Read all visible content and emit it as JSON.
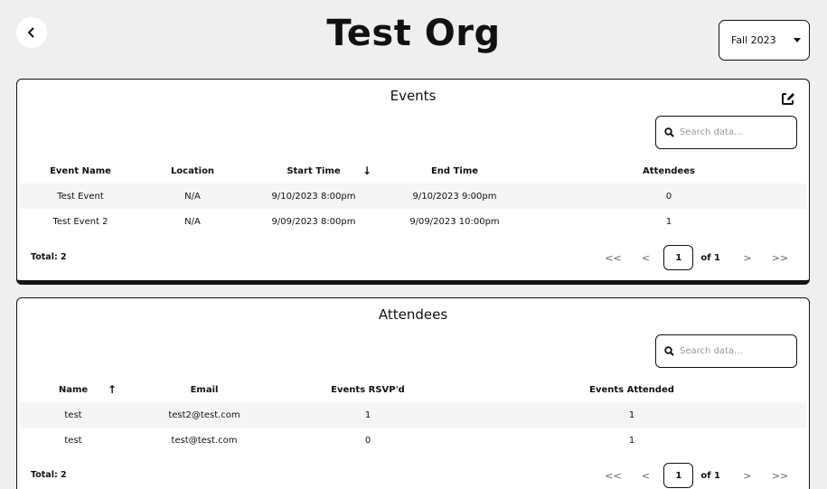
{
  "header": {
    "title": "Test Org",
    "term": "Fall 2023"
  },
  "events": {
    "title": "Events",
    "search_placeholder": "Search data...",
    "columns": [
      "Event Name",
      "Location",
      "Start Time",
      "End Time",
      "Attendees"
    ],
    "sort_column": "Start Time",
    "sort_direction": "descending",
    "rows": [
      [
        "Test Event",
        "N/A",
        "9/10/2023 8:00pm",
        "9/10/2023 9:00pm",
        "0"
      ],
      [
        "Test Event 2",
        "N/A",
        "9/09/2023 8:00pm",
        "9/09/2023 10:00pm",
        "1"
      ]
    ],
    "total": "Total: 2",
    "pager": {
      "first": "<<",
      "prev": "<",
      "page": "1",
      "of": "of 1",
      "next": ">",
      "last": ">>"
    }
  },
  "attendees": {
    "title": "Attendees",
    "search_placeholder": "Search data...",
    "columns": [
      "Name",
      "Email",
      "Events RSVP'd",
      "Events Attended"
    ],
    "sort_column": "Name",
    "sort_direction": "ascending",
    "rows": [
      [
        "test",
        "test2@test.com",
        "1",
        "1"
      ],
      [
        "test",
        "test@test.com",
        "0",
        "1"
      ]
    ],
    "total": "Total: 2",
    "pager": {
      "first": "<<",
      "prev": "<",
      "page": "1",
      "of": "of 1",
      "next": ">",
      "last": ">>"
    }
  }
}
